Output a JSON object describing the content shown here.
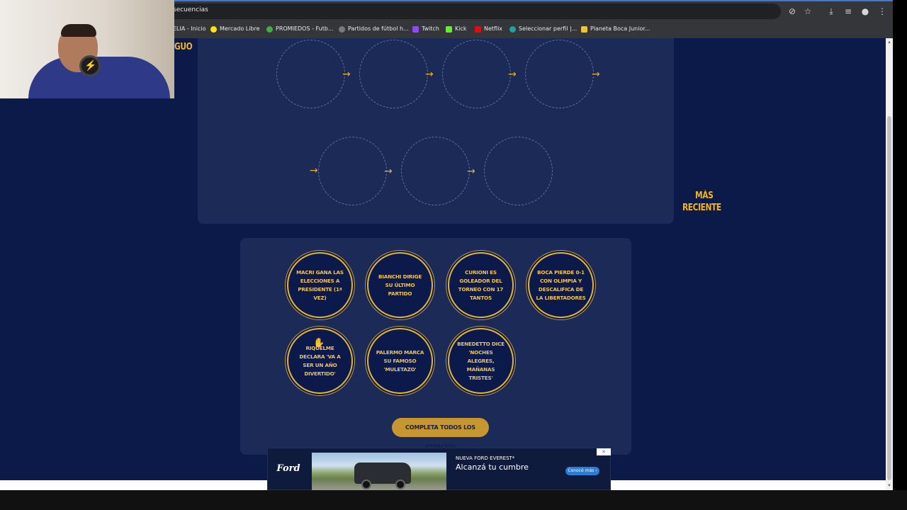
{
  "browser": {
    "url_text": "secuencias",
    "bookmarks": [
      {
        "label": "ELIA - Inicio",
        "icon": "elia-icon",
        "color": "#35363a"
      },
      {
        "label": "Mercado Libre",
        "icon": "mercadolibre-icon",
        "color": "#ffe600"
      },
      {
        "label": "PROMIEDOS - Futb...",
        "icon": "promiedos-icon",
        "color": "#3cb043"
      },
      {
        "label": "Partidos de fútbol h...",
        "icon": "football-icon",
        "color": "#7a7a7a"
      },
      {
        "label": "Twitch",
        "icon": "twitch-icon",
        "color": "#9146ff"
      },
      {
        "label": "Kick",
        "icon": "kick-icon",
        "color": "#53fc18"
      },
      {
        "label": "Netflix",
        "icon": "netflix-icon",
        "color": "#e50914"
      },
      {
        "label": "Seleccionar perfil |...",
        "icon": "profile-icon",
        "color": "#1aa3a3"
      },
      {
        "label": "Planeta Boca Junior...",
        "icon": "boca-icon",
        "color": "#f2c230"
      }
    ]
  },
  "game": {
    "left_label": "GUO",
    "right_label_line1": "MÁS",
    "right_label_line2": "RECIENTE",
    "arrow_glyph": "→",
    "events": [
      {
        "text": "Macri gana las elecciones a presidente (1ª vez)"
      },
      {
        "text": "Bianchi dirige su último partido"
      },
      {
        "text": "Curioni es goleador del torneo con 17 tantos"
      },
      {
        "text": "Boca pierde 0-1 con Olimpia y descalifica de la Libertadores"
      },
      {
        "text": "Riquelme declara 'va a ser un año divertido'"
      },
      {
        "text": "Palermo marca su famoso 'muletazo'"
      },
      {
        "text": "Benedetto dice 'noches alegres, mañanas tristes'"
      }
    ],
    "complete_button": "COMPLETA TODOS LOS ESPACIOS",
    "colors": {
      "accent": "#e8b02b",
      "background": "#0c1a4a",
      "panel": "#1c2a57"
    }
  },
  "ad": {
    "brand": "Ford",
    "subtitle": "NUEVA FORD EVEREST*",
    "headline": "Alcanzá tu cumbre",
    "cta": "Conocé más ›",
    "close": "✕"
  }
}
